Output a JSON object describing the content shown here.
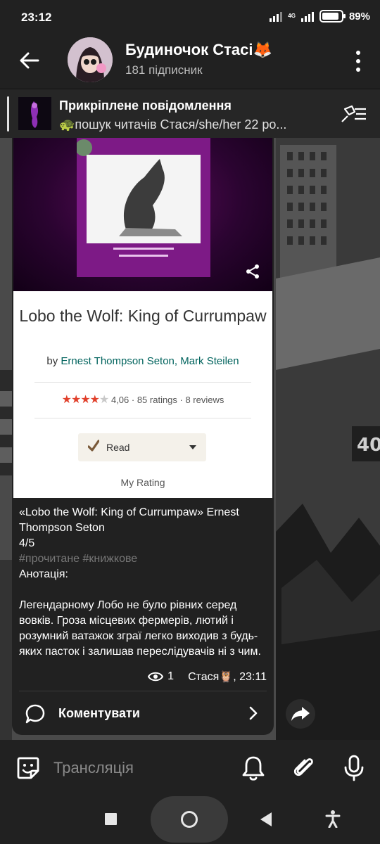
{
  "status_bar": {
    "time": "23:12",
    "network": "4G",
    "battery": "89%",
    "battery_level": 0.89
  },
  "header": {
    "title": "Будиночок Стасі🦊",
    "subtitle": "181 підписник",
    "back_icon": "arrow-left-icon",
    "menu_icon": "more-vertical-icon"
  },
  "pinned": {
    "title": "Прикріплене повідомлення",
    "text": "🐢пошук читачів  Стася/she/her 22 ро..."
  },
  "post": {
    "book_card": {
      "title": "Lobo the Wolf: King of Currumpaw",
      "by_prefix": "by",
      "authors": "Ernest Thompson Seton, Mark Steilen",
      "stars": "★★★★",
      "stars_off": "★",
      "rating_text": "4,06 · 85 ratings · 8 reviews",
      "shelf_button": "Read",
      "my_rating_label": "My Rating"
    },
    "caption_line1": "«Lobo the Wolf: King of Currumpaw»  Ernest Thompson Seton",
    "caption_line2": " 4/5",
    "hashtags": "#прочитане #книжкове",
    "annotation_label": " Анотація:",
    "annotation_text": " Легендарному Лобо не було рівних серед вовків. Гроза місцевих фермерів, лютий і розумний ватажок зграї легко виходив з будь-яких пасток і залишав переслідувачів ні з чим.",
    "views": "1",
    "author_sig": "Стася🦉, 23:11",
    "comment_label": "Коментувати"
  },
  "bottom_bar": {
    "placeholder": "Трансляція"
  },
  "colors": {
    "background": "#1b1b1b",
    "bubble": "#212121",
    "star_on": "#e1402b",
    "author_link": "#00635d",
    "hashtag": "#777777"
  }
}
